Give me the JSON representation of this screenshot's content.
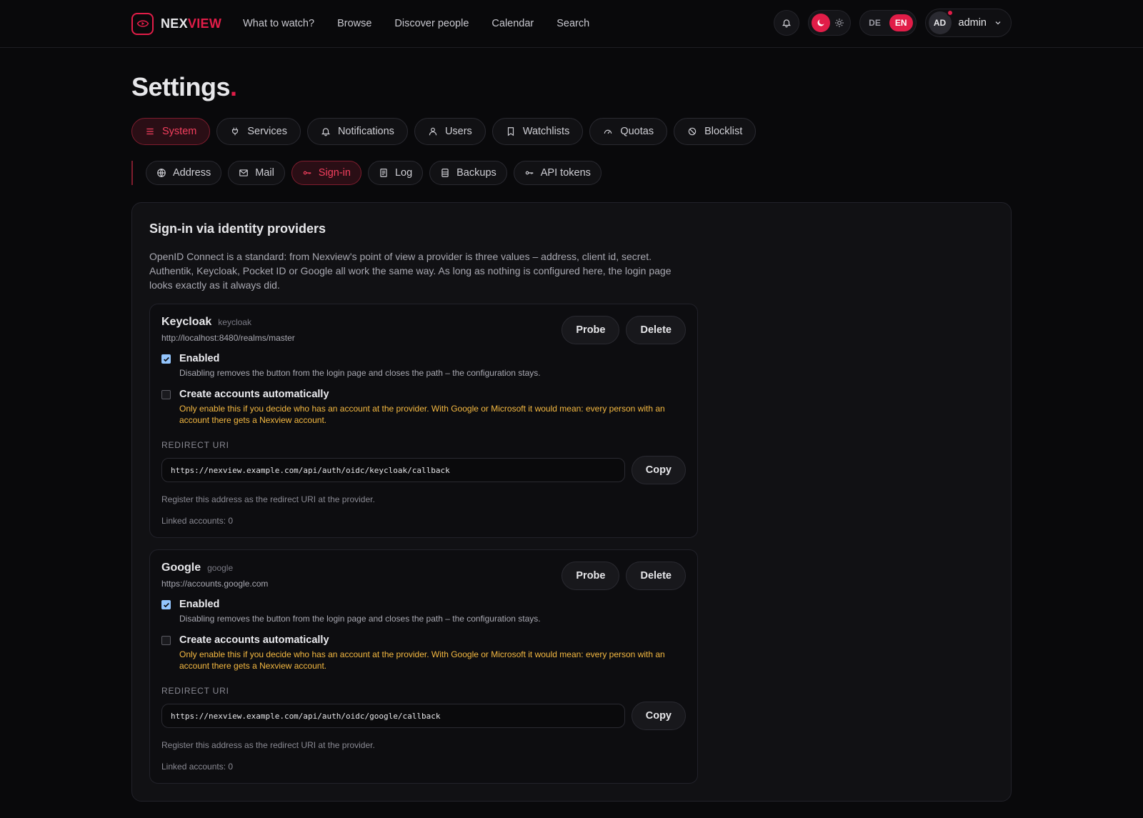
{
  "app": {
    "logo_part1": "NEX",
    "logo_part2": "VIEW"
  },
  "nav": [
    "What to watch?",
    "Browse",
    "Discover people",
    "Calendar",
    "Search"
  ],
  "lang": {
    "de": "DE",
    "en": "EN"
  },
  "user": {
    "initials": "AD",
    "name": "admin"
  },
  "page": {
    "title": "Settings",
    "title_dot": "."
  },
  "tabs": [
    {
      "label": "System",
      "icon": "menu-icon"
    },
    {
      "label": "Services",
      "icon": "plug-icon"
    },
    {
      "label": "Notifications",
      "icon": "bell-icon"
    },
    {
      "label": "Users",
      "icon": "user-icon"
    },
    {
      "label": "Watchlists",
      "icon": "bookmark-icon"
    },
    {
      "label": "Quotas",
      "icon": "gauge-icon"
    },
    {
      "label": "Blocklist",
      "icon": "ban-icon"
    }
  ],
  "subtabs": [
    {
      "label": "Address",
      "icon": "globe-icon"
    },
    {
      "label": "Mail",
      "icon": "mail-icon"
    },
    {
      "label": "Sign-in",
      "icon": "key-icon"
    },
    {
      "label": "Log",
      "icon": "log-icon"
    },
    {
      "label": "Backups",
      "icon": "database-icon"
    },
    {
      "label": "API tokens",
      "icon": "key-icon"
    }
  ],
  "card": {
    "title": "Sign-in via identity providers",
    "description": "OpenID Connect is a standard: from Nexview's point of view a provider is three values – address, client id, secret. Authentik, Keycloak, Pocket ID or Google all work the same way. As long as nothing is configured here, the login page looks exactly as it always did."
  },
  "labels": {
    "probe": "Probe",
    "delete": "Delete",
    "copy": "Copy",
    "enabled": "Enabled",
    "enabled_help": "Disabling removes the button from the login page and closes the path – the configuration stays.",
    "auto_create": "Create accounts automatically",
    "auto_create_help": "Only enable this if you decide who has an account at the provider. With Google or Microsoft it would mean: every person with an account there gets a Nexview account.",
    "redirect_uri": "REDIRECT URI",
    "redirect_hint": "Register this address as the redirect URI at the provider."
  },
  "providers": [
    {
      "name": "Keycloak",
      "key": "keycloak",
      "url": "http://localhost:8480/realms/master",
      "enabled": true,
      "auto_create": false,
      "redirect_uri": "https://nexview.example.com/api/auth/oidc/keycloak/callback",
      "linked": "Linked accounts: 0"
    },
    {
      "name": "Google",
      "key": "google",
      "url": "https://accounts.google.com",
      "enabled": true,
      "auto_create": false,
      "redirect_uri": "https://nexview.example.com/api/auth/oidc/google/callback",
      "linked": "Linked accounts: 0"
    }
  ],
  "colors": {
    "accent": "#e11d48",
    "warning": "#f5b941",
    "checkbox": "#93c5fd"
  }
}
